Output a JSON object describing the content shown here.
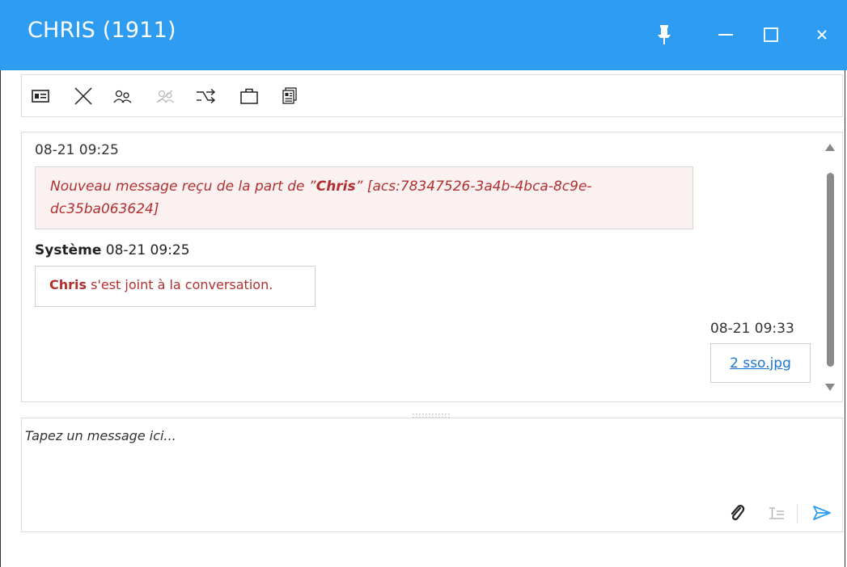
{
  "window": {
    "title": "CHRIS (1911)",
    "accent_color": "#2e9cf0",
    "controls": [
      "pin-icon",
      "minimize-icon",
      "maximize-icon",
      "close-icon"
    ]
  },
  "toolbar": {
    "icons": [
      "contact-card-icon",
      "close-conversation-icon",
      "participants-icon",
      "remove-participants-icon",
      "transfer-icon",
      "briefcase-icon",
      "conversation-history-icon"
    ]
  },
  "messages": {
    "first": {
      "timestamp": "08-21 09:25",
      "prefix": "Nouveau message reçu de la part de ",
      "open_quote": "”",
      "name": "Chris",
      "close_quote": "”",
      "suffix": " [acs:78347526-3a4b-4bca-8c9e-dc35ba063624]"
    },
    "second": {
      "sender": "Système",
      "timestamp": "08-21 09:25",
      "name": "Chris",
      "text": " s'est joint à la conversation."
    },
    "third": {
      "timestamp": "08-21 09:33",
      "file_link": "2 sso.jpg"
    }
  },
  "compose": {
    "placeholder": "Tapez un message ici...",
    "icons": [
      "attach-icon",
      "text-format-icon",
      "send-icon"
    ]
  },
  "colors": {
    "system_text": "#b03030",
    "system_bg": "#fcf1f1",
    "link": "#1a73d9"
  }
}
